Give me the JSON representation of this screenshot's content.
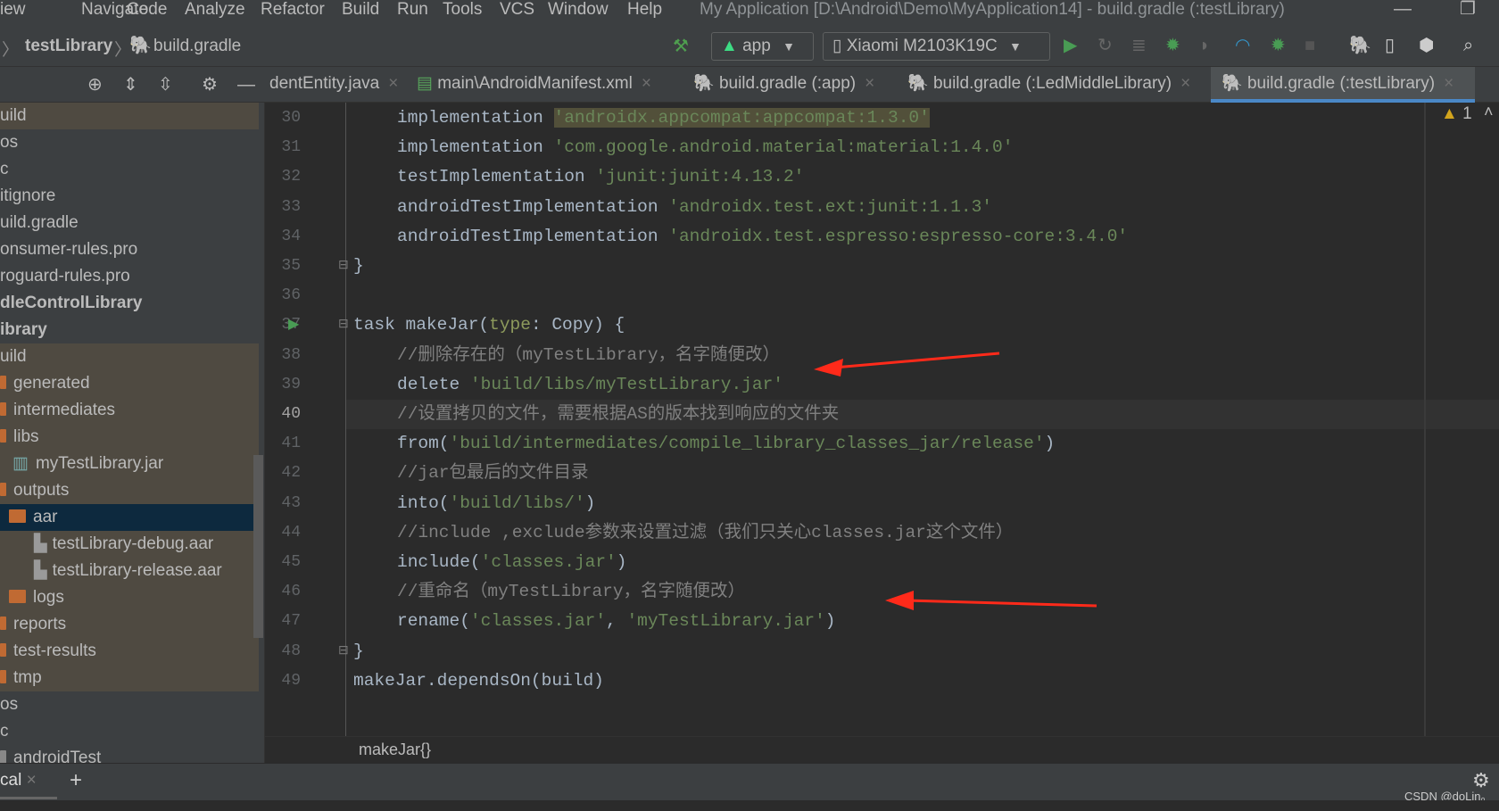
{
  "menu": {
    "items": [
      "iew",
      "Navigate",
      "Code",
      "Analyze",
      "Refactor",
      "Build",
      "Run",
      "Tools",
      "VCS",
      "Window",
      "Help"
    ],
    "title": "My Application [D:\\Android\\Demo\\MyApplication14] - build.gradle (:testLibrary)"
  },
  "nav": {
    "crumbs": [
      "testLibrary",
      "build.gradle"
    ],
    "config": "app",
    "device": "Xiaomi M2103K19C"
  },
  "icons": {
    "hammer": "hammer-icon",
    "run": "run-icon",
    "debug": "debug-icon",
    "search": "search-icon"
  },
  "tabs": [
    {
      "label": "dentEntity.java"
    },
    {
      "label": "main\\AndroidManifest.xml"
    },
    {
      "label": "build.gradle (:app)"
    },
    {
      "label": "build.gradle (:LedMiddleLibrary)"
    },
    {
      "label": "build.gradle (:testLibrary)",
      "active": true
    }
  ],
  "tree": [
    {
      "label": "uild",
      "style": "ex"
    },
    {
      "label": "os"
    },
    {
      "label": "c"
    },
    {
      "label": "itignore"
    },
    {
      "label": "uild.gradle"
    },
    {
      "label": "onsumer-rules.pro"
    },
    {
      "label": "roguard-rules.pro"
    },
    {
      "label": "dleControlLibrary",
      "style": "bold"
    },
    {
      "label": "ibrary",
      "style": "bold"
    },
    {
      "label": "uild",
      "style": "ex"
    },
    {
      "label": "generated",
      "style": "ex",
      "icon": "folder-part"
    },
    {
      "label": "intermediates",
      "style": "ex",
      "icon": "folder-part"
    },
    {
      "label": "libs",
      "style": "ex",
      "icon": "folder-part"
    },
    {
      "label": "myTestLibrary.jar",
      "style": "ex",
      "icon": "jar",
      "indent": 1
    },
    {
      "label": "outputs",
      "style": "ex",
      "icon": "folder-part"
    },
    {
      "label": "aar",
      "style": "sel",
      "icon": "folder",
      "indent": 1
    },
    {
      "label": "testLibrary-debug.aar",
      "style": "ex",
      "icon": "aar",
      "indent": 2
    },
    {
      "label": "testLibrary-release.aar",
      "style": "ex",
      "icon": "aar",
      "indent": 2
    },
    {
      "label": "logs",
      "style": "ex",
      "icon": "folder",
      "indent": 1
    },
    {
      "label": "reports",
      "style": "ex",
      "icon": "folder-part"
    },
    {
      "label": "test-results",
      "style": "ex",
      "icon": "folder-part"
    },
    {
      "label": "tmp",
      "style": "ex",
      "icon": "folder-part"
    },
    {
      "label": "os"
    },
    {
      "label": "c"
    },
    {
      "label": "androidTest",
      "icon": "folder-part-gray"
    }
  ],
  "code": [
    {
      "n": "30",
      "indent": 1,
      "t": [
        [
          "k",
          "implementation "
        ],
        [
          "s hl",
          "'androidx.appcompat:appcompat:1.3.0'"
        ]
      ]
    },
    {
      "n": "31",
      "indent": 1,
      "t": [
        [
          "k",
          "implementation "
        ],
        [
          "s",
          "'com.google.android.material:material:1.4.0'"
        ]
      ]
    },
    {
      "n": "32",
      "indent": 1,
      "t": [
        [
          "k",
          "testImplementation "
        ],
        [
          "s",
          "'junit:junit:4.13.2'"
        ]
      ]
    },
    {
      "n": "33",
      "indent": 1,
      "t": [
        [
          "k",
          "androidTestImplementation "
        ],
        [
          "s",
          "'androidx.test.ext:junit:1.1.3'"
        ]
      ]
    },
    {
      "n": "34",
      "indent": 1,
      "t": [
        [
          "k",
          "androidTestImplementation "
        ],
        [
          "s",
          "'androidx.test.espresso:espresso-core:3.4.0'"
        ]
      ]
    },
    {
      "n": "35",
      "indent": 0,
      "t": [
        [
          "k",
          "}"
        ]
      ]
    },
    {
      "n": "36",
      "indent": 0,
      "t": []
    },
    {
      "n": "37",
      "indent": 0,
      "t": [
        [
          "k",
          "task makeJar("
        ],
        [
          "n",
          "type"
        ],
        [
          "k",
          ": Copy) {"
        ]
      ]
    },
    {
      "n": "38",
      "indent": 1,
      "t": [
        [
          "c",
          "//删除存在的（myTestLibrary，名字随便改）"
        ]
      ]
    },
    {
      "n": "39",
      "indent": 1,
      "t": [
        [
          "k",
          "delete "
        ],
        [
          "s",
          "'build/libs/myTestLibrary.jar'"
        ]
      ]
    },
    {
      "n": "40",
      "indent": 1,
      "cur": true,
      "t": [
        [
          "c",
          "//设置拷贝的文件，需要根据AS的版本找到响应的文件夹"
        ]
      ]
    },
    {
      "n": "41",
      "indent": 1,
      "t": [
        [
          "k",
          "from("
        ],
        [
          "s",
          "'build/intermediates/compile_library_classes_jar/release'"
        ],
        [
          "k",
          ")"
        ]
      ]
    },
    {
      "n": "42",
      "indent": 1,
      "t": [
        [
          "c",
          "//jar包最后的文件目录"
        ]
      ]
    },
    {
      "n": "43",
      "indent": 1,
      "t": [
        [
          "k",
          "into("
        ],
        [
          "s",
          "'build/libs/'"
        ],
        [
          "k",
          ")"
        ]
      ]
    },
    {
      "n": "44",
      "indent": 1,
      "t": [
        [
          "c",
          "//include ,exclude参数来设置过滤（我们只关心classes.jar这个文件）"
        ]
      ]
    },
    {
      "n": "45",
      "indent": 1,
      "t": [
        [
          "k",
          "include("
        ],
        [
          "s",
          "'classes.jar'"
        ],
        [
          "k",
          ")"
        ]
      ]
    },
    {
      "n": "46",
      "indent": 1,
      "t": [
        [
          "c",
          "//重命名（myTestLibrary，名字随便改）"
        ]
      ]
    },
    {
      "n": "47",
      "indent": 1,
      "t": [
        [
          "k",
          "rename("
        ],
        [
          "s",
          "'classes.jar'"
        ],
        [
          "k",
          ", "
        ],
        [
          "s",
          "'myTestLibrary.jar'"
        ],
        [
          "k",
          ")"
        ]
      ]
    },
    {
      "n": "48",
      "indent": 0,
      "t": [
        [
          "k",
          "}"
        ]
      ]
    },
    {
      "n": "49",
      "indent": 0,
      "t": [
        [
          "k",
          "makeJar.dependsOn(build)"
        ]
      ]
    }
  ],
  "editor": {
    "warnings": "1",
    "breadcrumb": "makeJar{}"
  },
  "bottom": {
    "tab": "cal",
    "add": "+"
  },
  "watermark": "CSDN @doLin。",
  "colors": {
    "accent": "#4a88c7",
    "string": "#6a8759",
    "comment": "#808080",
    "arrow": "#ff2a1a"
  }
}
